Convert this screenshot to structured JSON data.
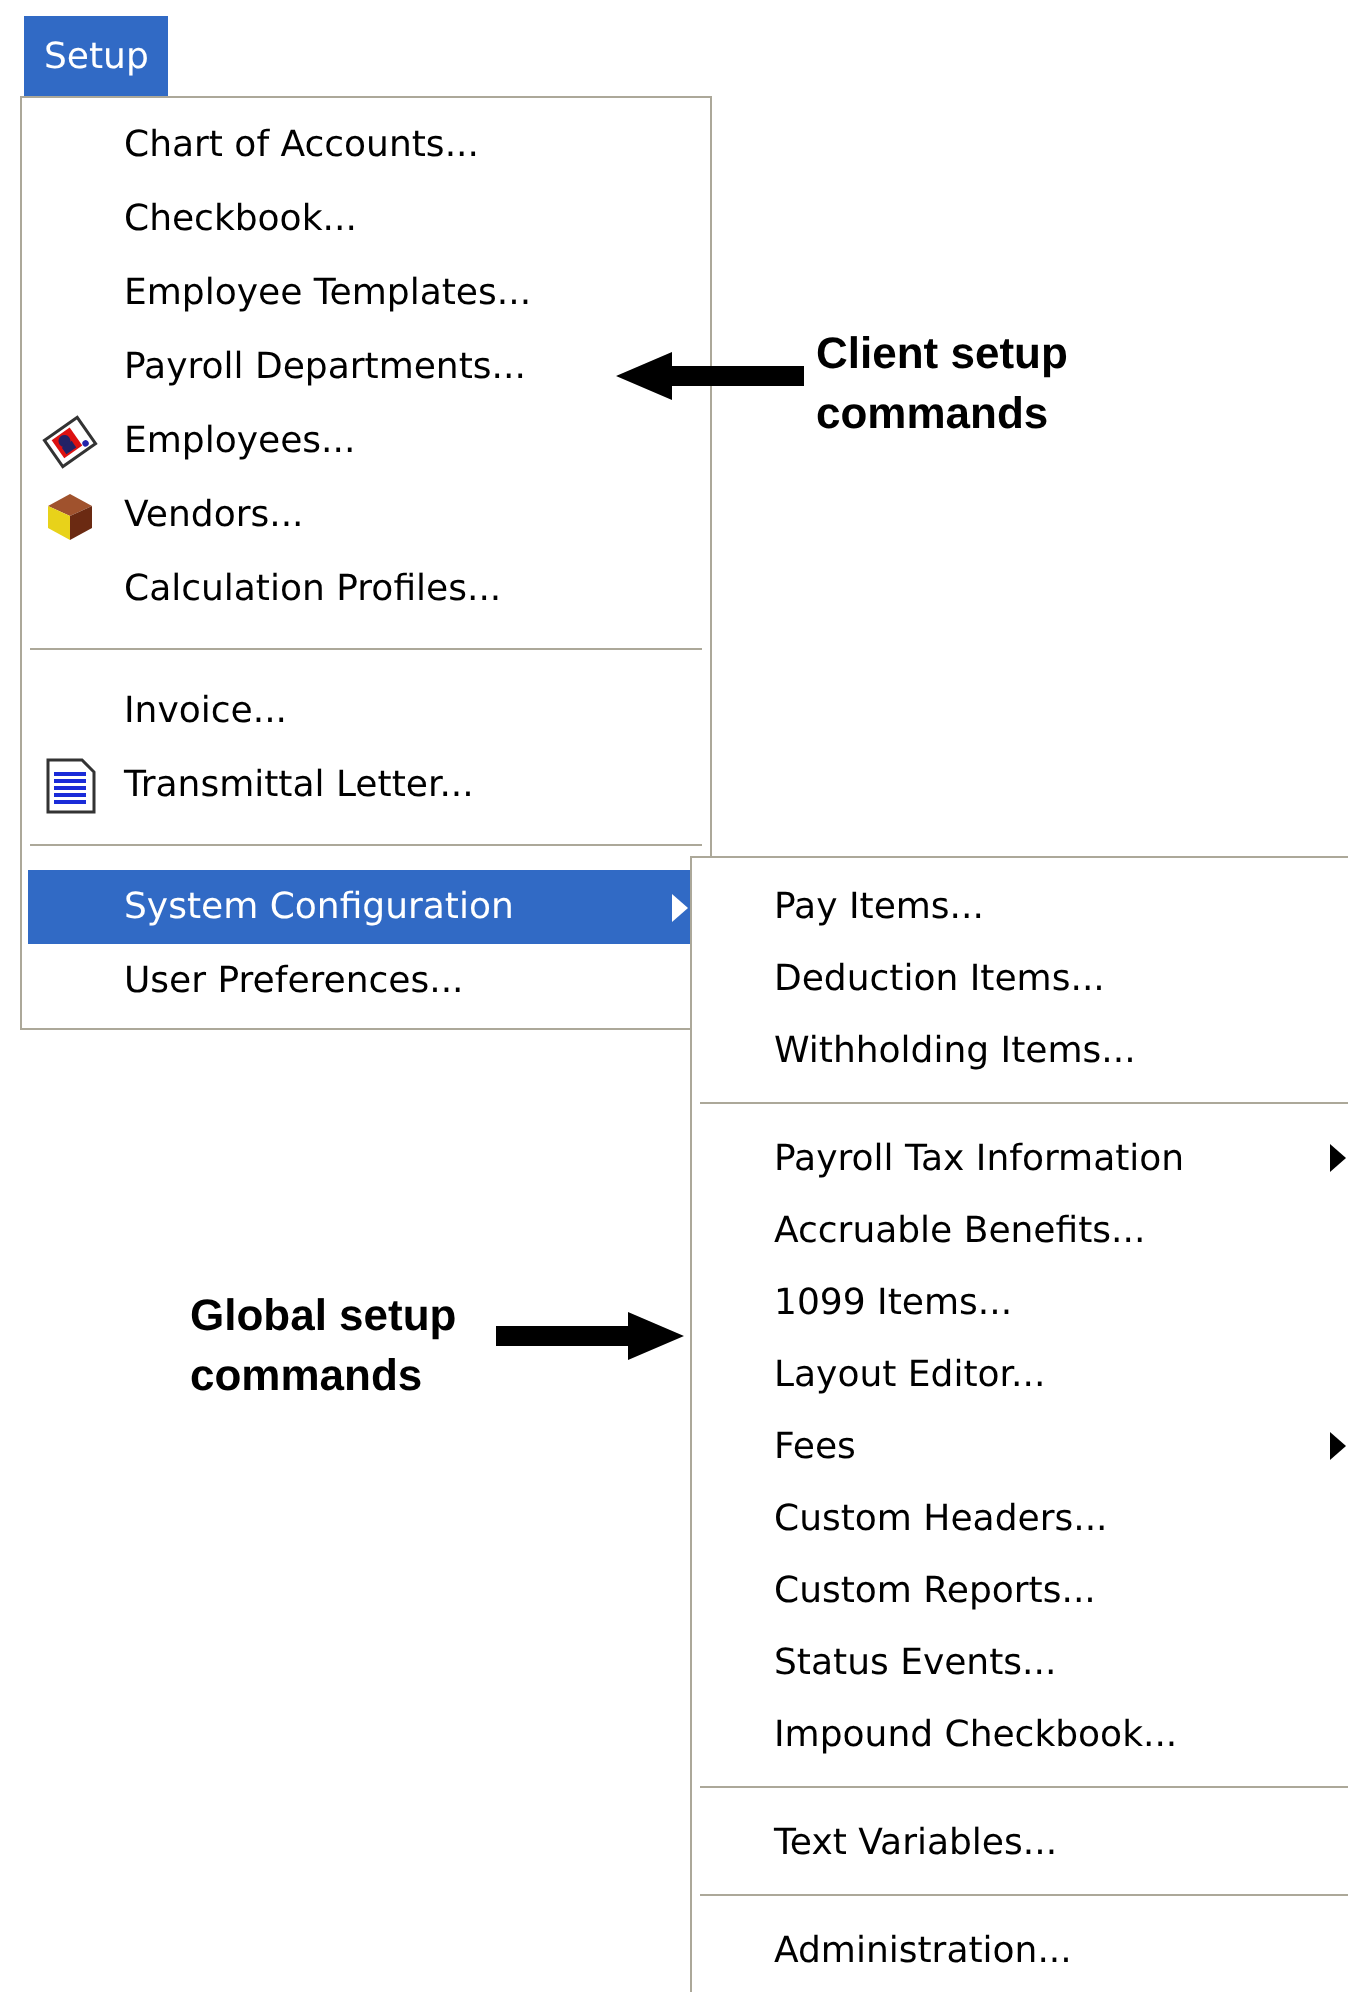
{
  "menu_bar": [
    {
      "label": "Setup",
      "selected": true
    }
  ],
  "setup_menu": [
    {
      "kind": "item",
      "label": "Chart of Accounts...",
      "submenu": false,
      "selected": false
    },
    {
      "kind": "item",
      "label": "Checkbook...",
      "submenu": false,
      "selected": false
    },
    {
      "kind": "item",
      "label": "Employee Templates...",
      "submenu": false,
      "selected": false
    },
    {
      "kind": "item",
      "label": "Payroll Departments...",
      "submenu": false,
      "selected": false
    },
    {
      "kind": "item",
      "label": "Employees...",
      "submenu": false,
      "selected": false
    },
    {
      "kind": "item",
      "label": "Vendors...",
      "submenu": false,
      "selected": false
    },
    {
      "kind": "item",
      "label": "Calculation Profiles...",
      "submenu": false,
      "selected": false
    },
    {
      "kind": "separator"
    },
    {
      "kind": "item",
      "label": "Invoice...",
      "submenu": false,
      "selected": false
    },
    {
      "kind": "item",
      "label": "Transmittal Letter...",
      "submenu": false,
      "selected": false
    },
    {
      "kind": "separator"
    },
    {
      "kind": "item",
      "label": "System Configuration",
      "submenu": true,
      "selected": true
    },
    {
      "kind": "item",
      "label": "User Preferences...",
      "submenu": false,
      "selected": false
    }
  ],
  "system_configuration_menu": [
    {
      "kind": "item",
      "label": "Pay Items...",
      "submenu": false,
      "selected": false
    },
    {
      "kind": "item",
      "label": "Deduction Items...",
      "submenu": false,
      "selected": false
    },
    {
      "kind": "item",
      "label": "Withholding Items...",
      "submenu": false,
      "selected": false
    },
    {
      "kind": "separator"
    },
    {
      "kind": "item",
      "label": "Payroll Tax Information",
      "submenu": true,
      "selected": false
    },
    {
      "kind": "item",
      "label": "Accruable Benefits...",
      "submenu": false,
      "selected": false
    },
    {
      "kind": "item",
      "label": "1099 Items...",
      "submenu": false,
      "selected": false
    },
    {
      "kind": "item",
      "label": "Layout Editor...",
      "submenu": false,
      "selected": false
    },
    {
      "kind": "item",
      "label": "Fees",
      "submenu": true,
      "selected": false
    },
    {
      "kind": "item",
      "label": "Custom Headers...",
      "submenu": false,
      "selected": false
    },
    {
      "kind": "item",
      "label": "Custom Reports...",
      "submenu": false,
      "selected": false
    },
    {
      "kind": "item",
      "label": "Status Events...",
      "submenu": false,
      "selected": false
    },
    {
      "kind": "item",
      "label": "Impound Checkbook...",
      "submenu": false,
      "selected": false
    },
    {
      "kind": "separator"
    },
    {
      "kind": "item",
      "label": "Text Variables...",
      "submenu": false,
      "selected": false
    },
    {
      "kind": "separator"
    },
    {
      "kind": "item",
      "label": "Administration...",
      "submenu": false,
      "selected": false
    }
  ],
  "callouts": [
    {
      "text": "Client setup commands",
      "kind": "left"
    },
    {
      "text": "Global setup commands",
      "kind": "right"
    }
  ]
}
